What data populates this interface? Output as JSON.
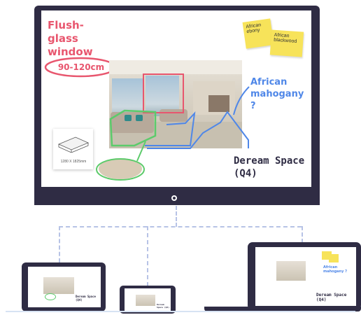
{
  "whiteboard": {
    "window_title": "Flush-glass window",
    "window_size": "90-120cm",
    "wood_question": "African mahogany ?",
    "project_name": "Deream Space (Q4)",
    "sofa_dims": "1280 X 1825mm"
  },
  "sticky_notes": [
    "African ebony",
    "African blackwood"
  ],
  "tablet": {
    "project_name": "Deream Space (Q4)"
  },
  "phone": {
    "project_name": "Deream Space (Q4)"
  },
  "laptop": {
    "wood_question": "African mahogany ?",
    "project_name": "Deream Space (Q4)"
  },
  "colors": {
    "frame": "#2f2c44",
    "pink_annotation": "#e8566e",
    "blue_annotation": "#4f87e8",
    "green_annotation": "#5ccb6b",
    "sticky": "#f7e35a",
    "connector": "#b7c3e6"
  }
}
